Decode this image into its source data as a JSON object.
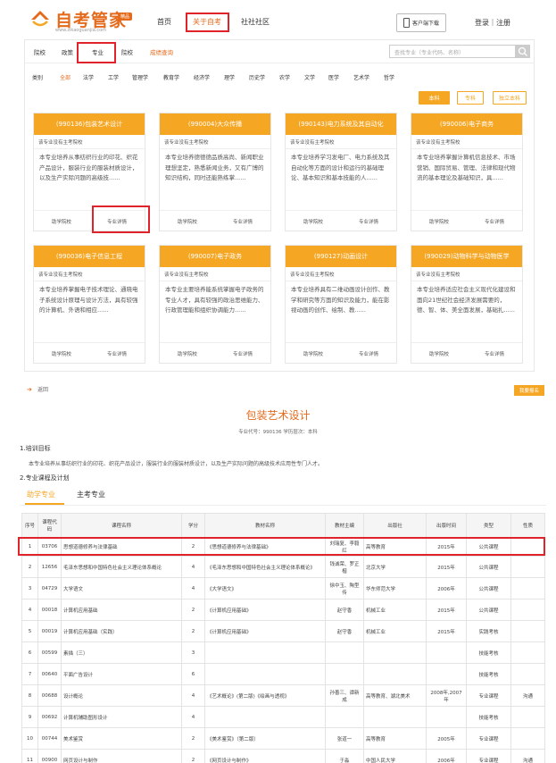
{
  "header": {
    "logo_text": "自考管家",
    "logo_badge": "精品",
    "logo_url": "www.zikaoguanjia.com",
    "nav": [
      "首页",
      "关于自考",
      "社社社区"
    ],
    "download_label": "客户端下载",
    "login_label": "登录｜注册"
  },
  "panel": {
    "tabs": [
      "院校",
      "政策",
      "专业",
      "院校",
      "成绩查询"
    ],
    "search_placeholder": "查找专业（专业代码、名称）",
    "categories": [
      "类别",
      "全部",
      "法学",
      "工学",
      "管理学",
      "教育学",
      "经济学",
      "理学",
      "历史学",
      "农学",
      "文学",
      "医学",
      "艺术学",
      "哲学"
    ],
    "levels": [
      "本科",
      "专科",
      "独立本科"
    ],
    "cards": [
      {
        "title": "(990136)包装艺术设计",
        "school": "该专业没有主考院校",
        "desc": "本专业培养从事纺织行业的印花、织花产品设计，服装行业的服装材质设计，以及生产实际问题的高级技......",
        "btn1": "助学院校",
        "btn2": "专业详情"
      },
      {
        "title": "(990004)大众传播",
        "school": "该专业没有主考院校",
        "desc": "本专业培养德德德品质高尚、新闻职业理想坚定，熟悉新闻业务，又有广博的知识结构，同时还能熟练掌......",
        "btn1": "助学院校",
        "btn2": "专业详情"
      },
      {
        "title": "(990143)电力系统及其自动化",
        "school": "该专业没有主考院校",
        "desc": "本专业培养学习发电厂、电力系统及其自动化等方面的设计和运行的基础理论、基本知识和基本技能的人......",
        "btn1": "助学院校",
        "btn2": "专业详情"
      },
      {
        "title": "(990006)电子商务",
        "school": "该专业没有主考院校",
        "desc": "本专业培养掌握计算机信息技术、市场营销、国际贸易、管理、法律和现代物流的基本理论及基础知识，具......",
        "btn1": "助学院校",
        "btn2": "专业详情"
      },
      {
        "title": "(990036)电子信息工程",
        "school": "该专业没有主考院校",
        "desc": "本专业培养掌握电子技术理论、通晓电子系统设计原理与设计方法，具有较强的计算机、外语和相应......",
        "btn1": "助学院校",
        "btn2": "专业详情"
      },
      {
        "title": "(990007)电子政务",
        "school": "该专业没有主考院校",
        "desc": "本专业主要培养能系统掌握电子政务的专业人才，具有较强的政治思维能力、行政管理能和组织协调能力......",
        "btn1": "助学院校",
        "btn2": "专业详情"
      },
      {
        "title": "(990127)动画设计",
        "school": "该专业没有主考院校",
        "desc": "本专业培养具有二维动画设计创作、教学和研究等方面的知识及能力，能在影视动画的创作、绘制、教......",
        "btn1": "助学院校",
        "btn2": "专业详情"
      },
      {
        "title": "(990029)动物科学与动物医学",
        "school": "该专业没有主考院校",
        "desc": "本专业培养适应社会主义现代化建设和面向21世纪社会经济发展需要的，德、智、体、美全面发展，基础扎......",
        "btn1": "助学院校",
        "btn2": "专业详情"
      }
    ]
  },
  "detail": {
    "back_label": "返回",
    "enroll_label": "我要报名",
    "title": "包装艺术设计",
    "meta": "专业代号：990136 学历层次：本科",
    "section1": "1.培训目标",
    "goal": "本专业培养从事纺织行业的印花、织花产品设计，服装行业的服装材质设计，以及生产实际问题的高级技术应用性专门人才。",
    "section2": "2.专业课程及计划",
    "subtabs": [
      "助学专业",
      "主考专业"
    ],
    "columns": [
      "序号",
      "课程代码",
      "课程名称",
      "学分",
      "教材名称",
      "教材主编",
      "出版社",
      "出版时间",
      "类型",
      "性质"
    ],
    "rows": [
      [
        "1",
        "03706",
        "思想道德修养与法律基础",
        "2",
        "《思想道德修养与法律基础》",
        "刘瑞复、李毅红",
        "高等教育",
        "2015年",
        "公共课程",
        ""
      ],
      [
        "2",
        "12656",
        "毛泽东思想和中国特色社会主义理论体系概论",
        "4",
        "《毛泽东思想和中国特色社会主义理论体系概论》",
        "钱诚荣、罗正楷",
        "北京大学",
        "2015年",
        "公共课程",
        ""
      ],
      [
        "3",
        "04729",
        "大学语文",
        "4",
        "《大学语文》",
        "徐中玉、陶型传",
        "华东师范大学",
        "2006年",
        "公共课程",
        ""
      ],
      [
        "4",
        "00018",
        "计算机应用基础",
        "2",
        "《计算机应用基础》",
        "赵守香",
        "机械工业",
        "2015年",
        "公共课程",
        ""
      ],
      [
        "5",
        "00019",
        "计算机应用基础（实践）",
        "2",
        "《计算机应用基础》",
        "赵守香",
        "机械工业",
        "2015年",
        "实践考核",
        ""
      ],
      [
        "6",
        "00599",
        "素描（三）",
        "3",
        "",
        "",
        "",
        "",
        "技能考核",
        ""
      ],
      [
        "7",
        "00640",
        "平面广告设计",
        "6",
        "",
        "",
        "",
        "",
        "技能考核",
        ""
      ],
      [
        "8",
        "00688",
        "设计概论",
        "4",
        "《艺术概论》(第二版)《绘画与透视》",
        "孙善三、谭新成",
        "高等教育、湖北美术",
        "2008年,2007年",
        "专业课程",
        "沟通"
      ],
      [
        "9",
        "00692",
        "计算机辅助图形设计",
        "4",
        "",
        "",
        "",
        "",
        "技能考核",
        ""
      ],
      [
        "10",
        "00744",
        "美术鉴赏",
        "2",
        "《美术鉴赏》（第二版）",
        "张道一",
        "高等教育",
        "2005年",
        "专业课程",
        ""
      ],
      [
        "11",
        "00900",
        "网页设计与制作",
        "2",
        "《网页设计与制作》",
        "于淼",
        "中国人民大学",
        "2006年",
        "专业课程",
        "沟通"
      ]
    ]
  }
}
